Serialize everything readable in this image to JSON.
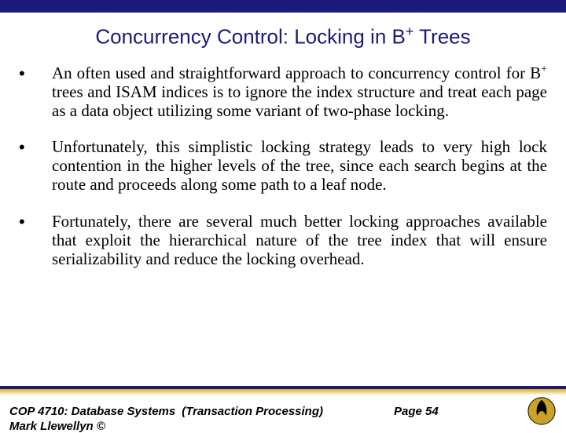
{
  "title_prefix": "Concurrency Control: Locking in B",
  "title_suffix": " Trees",
  "title_sup": "+",
  "bullets": [
    {
      "pre": "An often used and straightforward approach to concurrency control for B",
      "sup": "+",
      "post": " trees and ISAM indices is to ignore the index structure and treat each page as a data object utilizing some variant of two-phase locking."
    },
    {
      "pre": "Unfortunately, this simplistic locking strategy leads to very high lock contention in the higher levels of the tree, since each search begins at the route and proceeds along some path to a leaf node.",
      "sup": "",
      "post": ""
    },
    {
      "pre": "Fortunately, there are several much better locking approaches available that exploit the hierarchical nature of the tree index that will ensure serializability and reduce the locking overhead.",
      "sup": "",
      "post": ""
    }
  ],
  "footer": {
    "course": "COP 4710: Database Systems",
    "topic": "(Transaction Processing)",
    "page": "Page 54",
    "author": "Mark Llewellyn ©"
  }
}
